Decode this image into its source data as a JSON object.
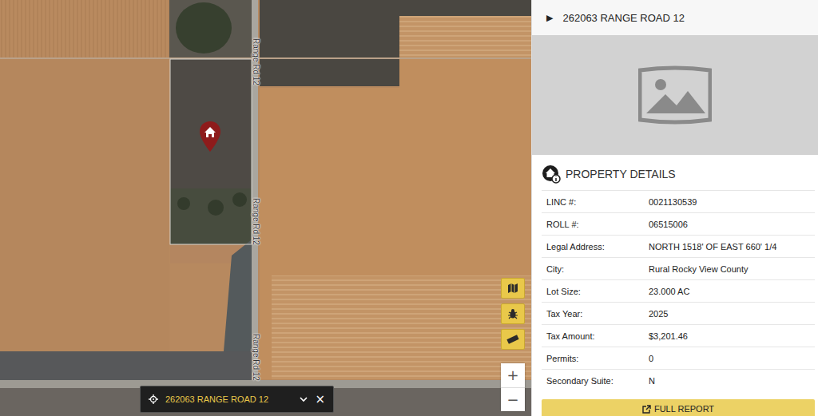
{
  "map": {
    "road_labels": [
      "Range Rd 12",
      "Range Rd 12",
      "Range Rd 12"
    ],
    "zoom_in": "+",
    "zoom_out": "−"
  },
  "address_bar": {
    "address": "262063 RANGE ROAD 12",
    "close": "×"
  },
  "panel": {
    "header": {
      "toggle": "▶",
      "title": "262063 RANGE ROAD 12"
    },
    "section_title": "PROPERTY DETAILS",
    "details": [
      {
        "label": "LINC #:",
        "value": "0021130539"
      },
      {
        "label": "ROLL #:",
        "value": "06515006"
      },
      {
        "label": "Legal Address:",
        "value": "NORTH 1518' OF EAST 660' 1/4"
      },
      {
        "label": "City:",
        "value": "Rural Rocky View County"
      },
      {
        "label": "Lot Size:",
        "value": "23.000 AC"
      },
      {
        "label": "Tax Year:",
        "value": "2025"
      },
      {
        "label": "Tax Amount:",
        "value": "$3,201.46"
      },
      {
        "label": "Permits:",
        "value": "0"
      },
      {
        "label": "Secondary Suite:",
        "value": "N"
      }
    ],
    "button": "FULL REPORT"
  }
}
